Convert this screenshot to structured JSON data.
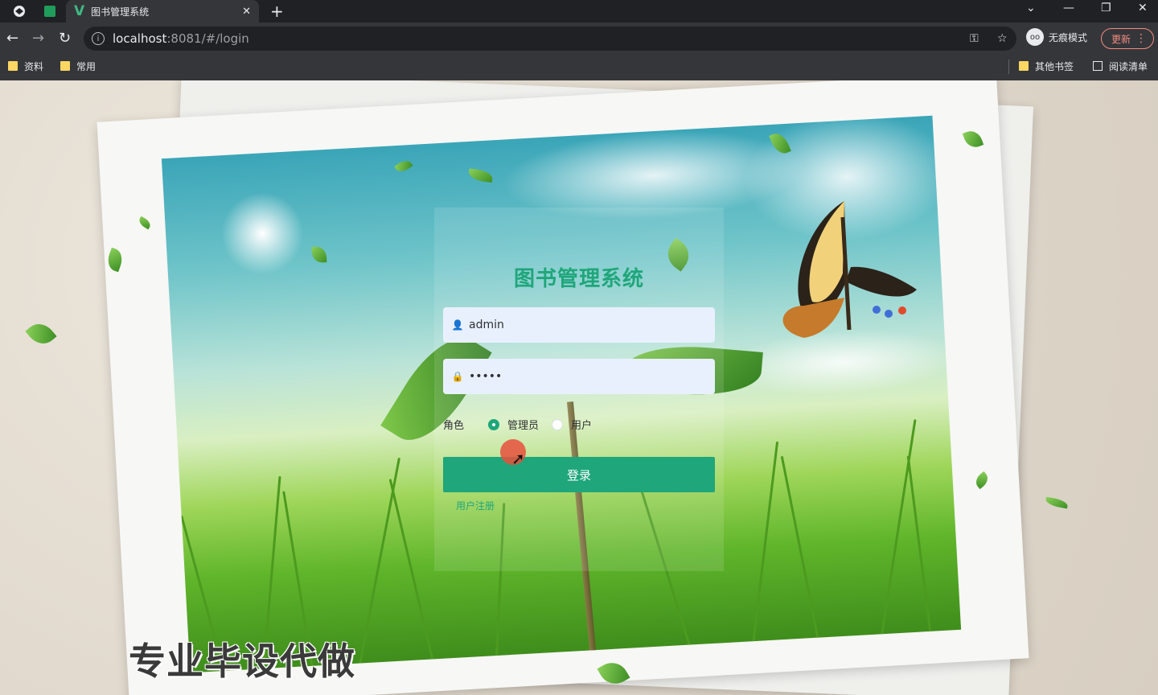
{
  "browser": {
    "tab_title": "图书管理系统",
    "url_host": "localhost",
    "url_rest": ":8081/#/login",
    "profile_label": "无痕模式",
    "update_label": "更新",
    "bookmarks": [
      "资料",
      "常用"
    ],
    "other_bookmarks": "其他书签",
    "reading_list": "阅读清单"
  },
  "login": {
    "title": "图书管理系统",
    "username_value": "admin",
    "password_value": "•••••",
    "role_label": "角色",
    "roles": [
      {
        "label": "管理员",
        "selected": true
      },
      {
        "label": "用户",
        "selected": false
      }
    ],
    "login_button": "登录",
    "register_link": "用户注册"
  },
  "overlay": {
    "watermark": "专业毕设代做"
  },
  "colors": {
    "accent": "#1fa67a",
    "input_bg": "#e8f0fe",
    "chrome_dark": "#202124",
    "chrome_toolbar": "#35363a"
  }
}
